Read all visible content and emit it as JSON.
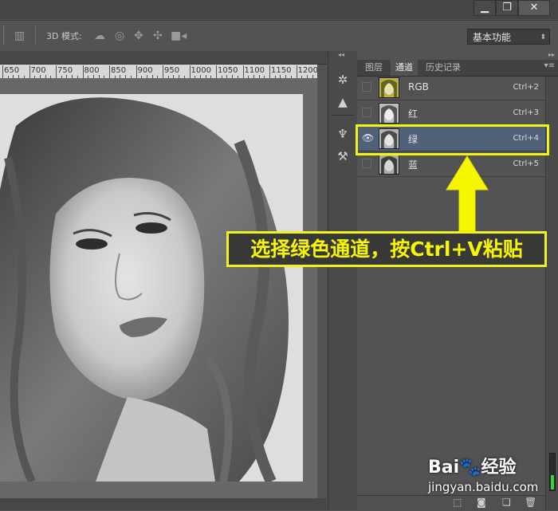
{
  "options_bar": {
    "label_3d": "3D 模式:",
    "workspace": "基本功能"
  },
  "ruler": {
    "ticks": [
      "650",
      "700",
      "750",
      "800",
      "850",
      "900",
      "950",
      "1000",
      "1050",
      "1100",
      "1150",
      "1200"
    ]
  },
  "panel": {
    "tabs": [
      "图层",
      "通道",
      "历史记录"
    ],
    "active_tab": "通道",
    "channels": [
      {
        "name": "RGB",
        "shortcut": "Ctrl+2",
        "visible": false,
        "selected": false
      },
      {
        "name": "红",
        "shortcut": "Ctrl+3",
        "visible": false,
        "selected": false
      },
      {
        "name": "绿",
        "shortcut": "Ctrl+4",
        "visible": true,
        "selected": true
      },
      {
        "name": "蓝",
        "shortcut": "Ctrl+5",
        "visible": false,
        "selected": false
      }
    ]
  },
  "annotation": {
    "text": "选择绿色通道，按Ctrl+V粘贴"
  },
  "watermark": {
    "logo": "Bai🐾经验",
    "url": "jingyan.baidu.com"
  },
  "colors": {
    "highlight": "#f2f21a",
    "selected_row": "#50617a"
  },
  "icons": {
    "minimize": "minimize-icon",
    "restore": "restore-icon",
    "close": "close-icon"
  }
}
